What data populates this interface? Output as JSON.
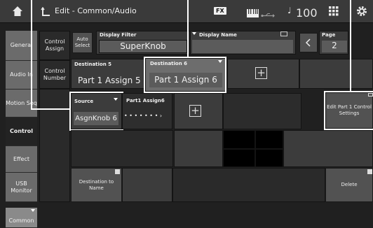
{
  "header": {
    "title": "Edit - Common/Audio",
    "fx_label": "FX",
    "tempo_symbol": "♩",
    "tempo_value": "100"
  },
  "nav": {
    "items": [
      "General",
      "Audio In",
      "Motion Seq",
      "Control",
      "Effect",
      "USB Monitor"
    ],
    "active": "Control",
    "sub_items": [
      "Control Assign",
      "Control Number"
    ],
    "common_tab": "Common"
  },
  "filter": {
    "auto_select_label": "Auto Select",
    "display_filter_label": "Display Filter",
    "display_filter_value": "SuperKnob",
    "display_name_label": "Display Name",
    "page_label": "Page",
    "page_value": "2"
  },
  "destinations": {
    "dest5_label": "Destination 5",
    "dest5_value": "Part 1 Assign 5",
    "dest6_label": "Destination 6",
    "dest6_value": "Part 1 Assign 6"
  },
  "source": {
    "label": "Source",
    "value": "AsgnKnob 6",
    "part_assign_label": "Part1 Assign6",
    "dots": "• • • • • • • ›"
  },
  "buttons": {
    "edit_part_settings": "Edit Part 1 Control Settings",
    "destination_to_name": "Destination to Name",
    "delete": "Delete"
  }
}
